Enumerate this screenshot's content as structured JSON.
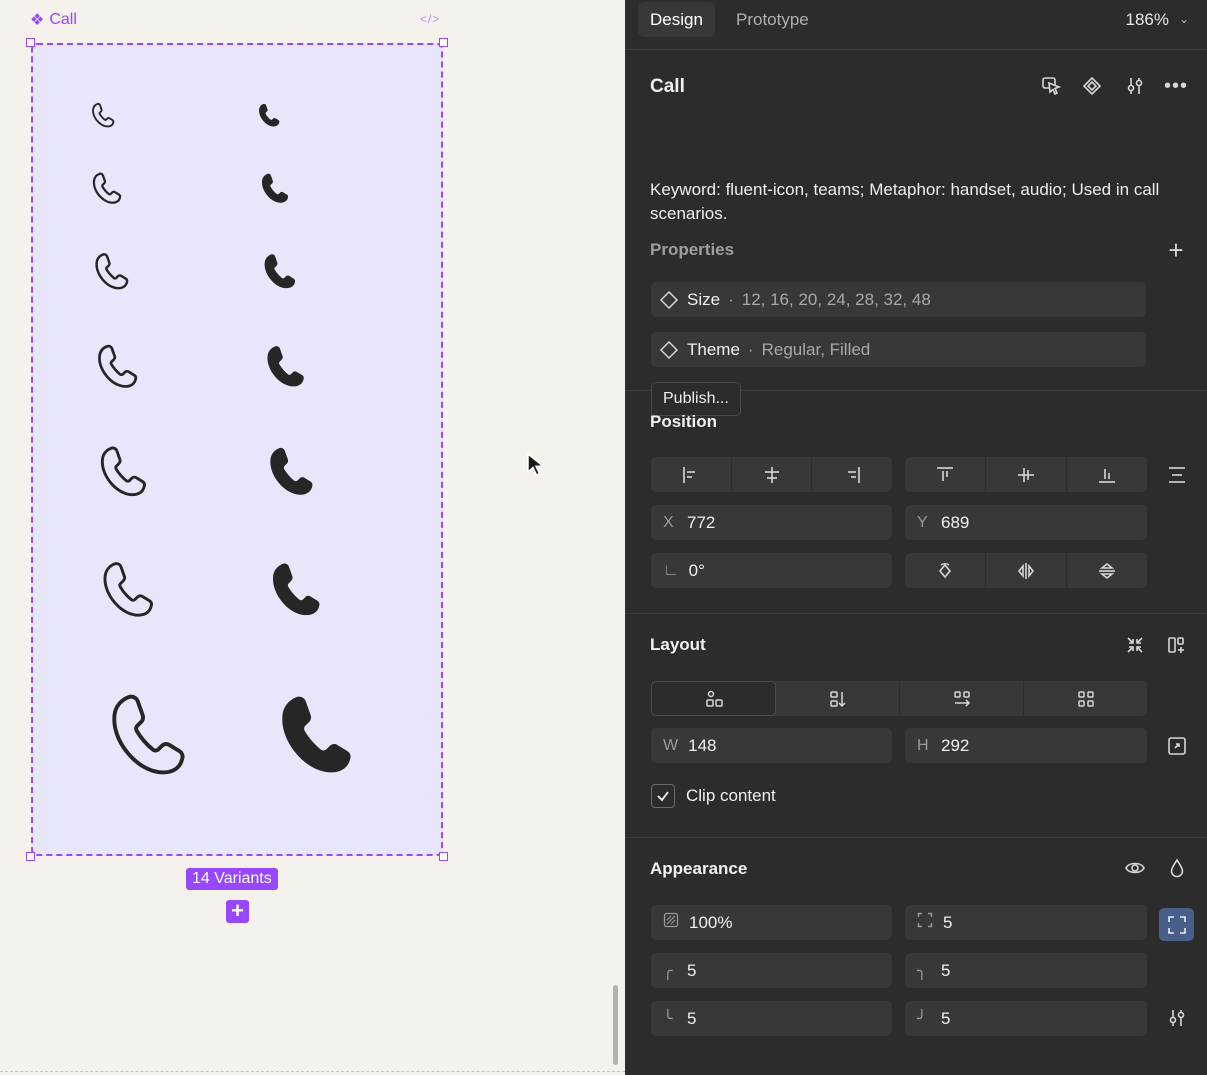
{
  "canvas": {
    "frame_label": "Call",
    "variants_badge": "14 Variants",
    "add_variant": "+"
  },
  "panel": {
    "tabs": [
      "Design",
      "Prototype"
    ],
    "zoom": "186%",
    "component": {
      "title": "Call",
      "description": "Keyword: fluent-icon, teams; Metaphor: handset, audio; Used in call scenarios.",
      "properties_label": "Properties",
      "properties": [
        {
          "name": "Size",
          "values": "12, 16, 20, 24, 28, 32, 48"
        },
        {
          "name": "Theme",
          "values": "Regular, Filled"
        }
      ],
      "publish_label": "Publish..."
    },
    "position": {
      "title": "Position",
      "x_label": "X",
      "x": "772",
      "y_label": "Y",
      "y": "689",
      "rotation": "0°"
    },
    "layout": {
      "title": "Layout",
      "w_label": "W",
      "w": "148",
      "h_label": "H",
      "h": "292",
      "clip_content_label": "Clip content",
      "clip_content": true
    },
    "appearance": {
      "title": "Appearance",
      "opacity": "100%",
      "radius_all": "5",
      "radius_tl": "5",
      "radius_tr": "5",
      "radius_bl": "5",
      "radius_br": "5"
    }
  }
}
